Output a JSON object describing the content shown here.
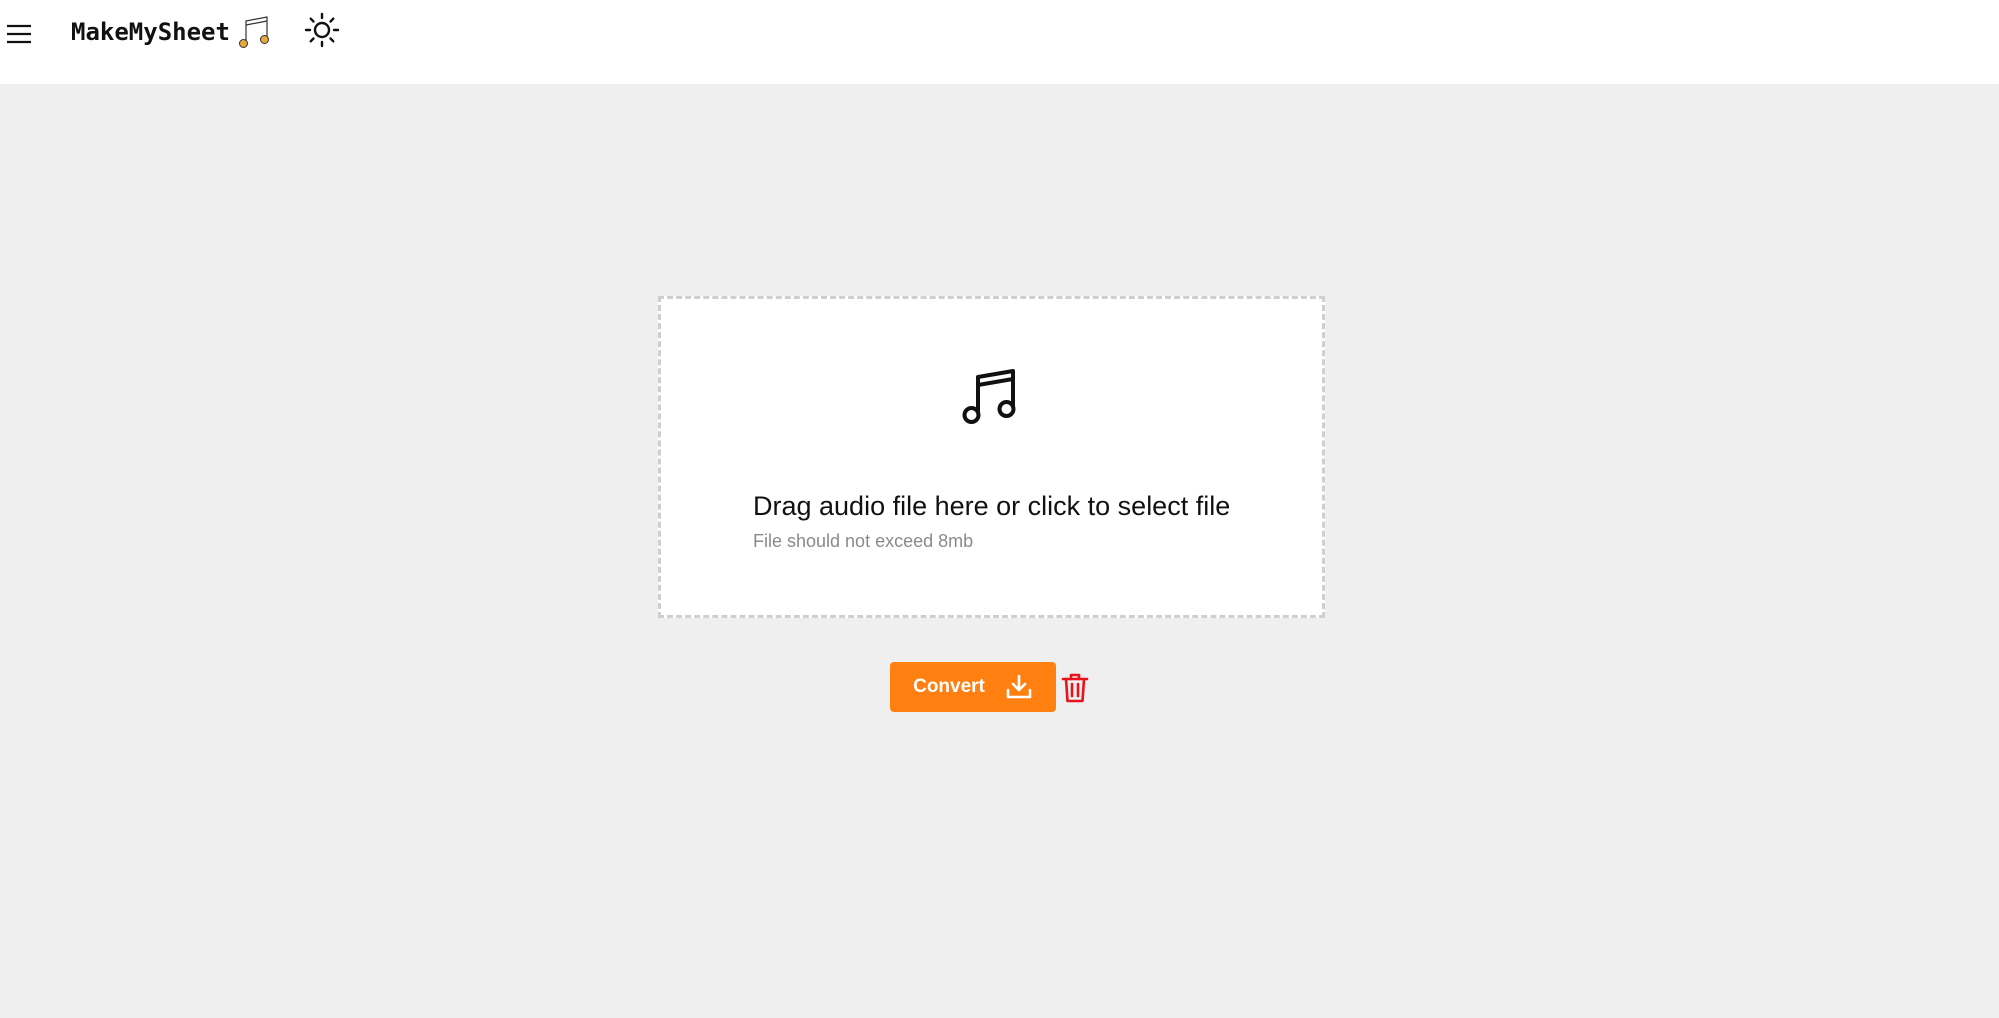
{
  "header": {
    "brand": "MakeMySheet",
    "menu_icon": "hamburger-menu-icon",
    "brand_icon": "music-notes-icon",
    "theme_icon": "sun-icon"
  },
  "dropzone": {
    "icon": "music-note-icon",
    "title": "Drag audio file here or click to select file",
    "subtitle": "File should not exceed 8mb"
  },
  "actions": {
    "convert_label": "Convert",
    "convert_icon": "download-icon",
    "delete_icon": "trash-icon"
  },
  "colors": {
    "accent": "#ff7f11",
    "delete": "#e8141c",
    "background": "#efefef",
    "brand_icon_fill": "#e9a93a"
  }
}
